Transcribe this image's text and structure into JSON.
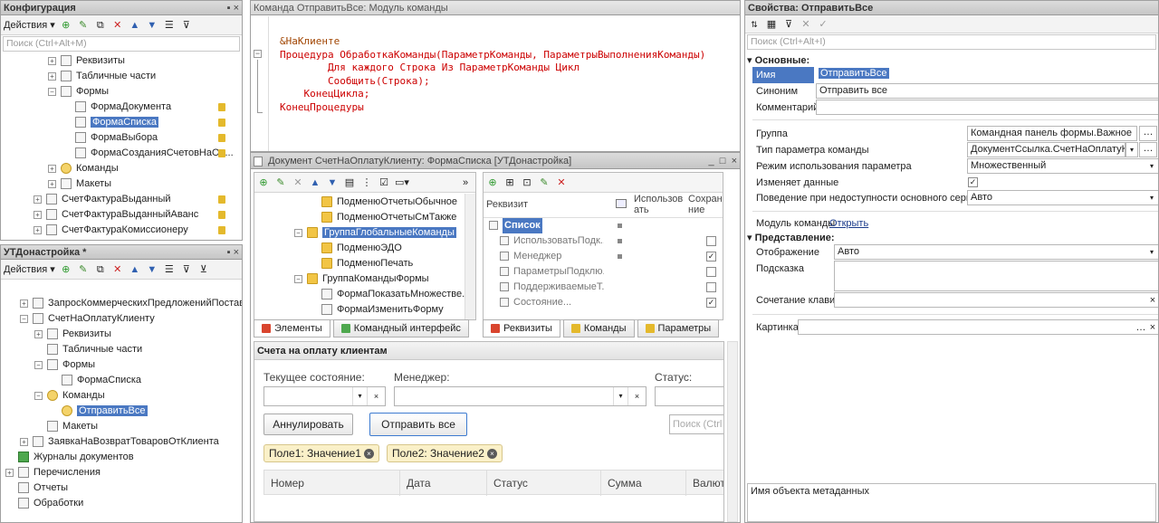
{
  "config": {
    "title": "Конфигурация",
    "actions_label": "Действия",
    "search_placeholder": "Поиск (Ctrl+Alt+M)",
    "tree": [
      {
        "label": "Реквизиты",
        "indent": 1,
        "expander": "+",
        "icon": "attributes-icon",
        "lock": false
      },
      {
        "label": "Табличные части",
        "indent": 1,
        "expander": "+",
        "icon": "table-icon",
        "lock": false
      },
      {
        "label": "Формы",
        "indent": 1,
        "expander": "−",
        "icon": "forms-icon",
        "lock": false
      },
      {
        "label": "ФормаДокумента",
        "indent": 2,
        "expander": "",
        "icon": "form-icon",
        "lock": true
      },
      {
        "label": "ФормаСписка",
        "indent": 2,
        "expander": "",
        "icon": "form-icon",
        "lock": true,
        "selected": true
      },
      {
        "label": "ФормаВыбора",
        "indent": 2,
        "expander": "",
        "icon": "form-icon",
        "lock": true
      },
      {
        "label": "ФормаСозданияСчетовНаОп...",
        "indent": 2,
        "expander": "",
        "icon": "form-icon",
        "lock": true
      },
      {
        "label": "Команды",
        "indent": 1,
        "expander": "+",
        "icon": "command-icon",
        "lock": false
      },
      {
        "label": "Макеты",
        "indent": 1,
        "expander": "+",
        "icon": "template-icon",
        "lock": false
      },
      {
        "label": "СчетФактураВыданный",
        "indent": 0,
        "expander": "+",
        "icon": "document-icon",
        "lock": true
      },
      {
        "label": "СчетФактураВыданныйАванс",
        "indent": 0,
        "expander": "+",
        "icon": "document-icon",
        "lock": true
      },
      {
        "label": "СчетФактураКомиссионеру",
        "indent": 0,
        "expander": "+",
        "icon": "document-icon",
        "lock": true
      }
    ]
  },
  "ut": {
    "title": "УТДонастройка *",
    "actions_label": "Действия",
    "tree": [
      {
        "label": "ЗапросКоммерческихПредложенийПостав",
        "indent": 1,
        "expander": "+",
        "icon": "document-icon"
      },
      {
        "label": "СчетНаОплатуКлиенту",
        "indent": 1,
        "expander": "−",
        "icon": "document-icon"
      },
      {
        "label": "Реквизиты",
        "indent": 2,
        "expander": "+",
        "icon": "attributes-icon"
      },
      {
        "label": "Табличные части",
        "indent": 2,
        "expander": "",
        "icon": "table-icon"
      },
      {
        "label": "Формы",
        "indent": 2,
        "expander": "−",
        "icon": "forms-icon"
      },
      {
        "label": "ФормаСписка",
        "indent": 3,
        "expander": "",
        "icon": "form-icon"
      },
      {
        "label": "Команды",
        "indent": 2,
        "expander": "−",
        "icon": "command-icon"
      },
      {
        "label": "ОтправитьВсе",
        "indent": 3,
        "expander": "",
        "icon": "command-icon",
        "selected": true
      },
      {
        "label": "Макеты",
        "indent": 2,
        "expander": "",
        "icon": "template-icon"
      },
      {
        "label": "ЗаявкаНаВозвратТоваровОтКлиента",
        "indent": 1,
        "expander": "+",
        "icon": "document-icon"
      },
      {
        "label": "Журналы документов",
        "indent": 0,
        "expander": "",
        "icon": "journal-icon"
      },
      {
        "label": "Перечисления",
        "indent": 0,
        "expander": "+",
        "icon": "enum-icon"
      },
      {
        "label": "Отчеты",
        "indent": 0,
        "expander": "",
        "icon": "report-icon"
      },
      {
        "label": "Обработки",
        "indent": 0,
        "expander": "",
        "icon": "processing-icon"
      }
    ]
  },
  "module": {
    "title": "Команда ОтправитьВсе: Модуль команды",
    "lines": [
      "&НаКлиенте",
      "Процедура ОбработкаКоманды(ПараметрКоманды, ПараметрыВыполненияКоманды)",
      "        Для каждого Строка Из ПараметрКоманды Цикл",
      "        Сообщить(Строка);",
      "    КонецЦикла;",
      "КонецПроцедуры"
    ]
  },
  "form_editor": {
    "title": "Документ СчетНаОплатуКлиенту: ФормаСписка [УТДонастройка]",
    "elements": [
      {
        "label": "ПодменюОтчетыОбычное",
        "indent": 2,
        "icon": "folder-icon",
        "expander": ""
      },
      {
        "label": "ПодменюОтчетыСмТакже",
        "indent": 2,
        "icon": "folder-icon",
        "expander": ""
      },
      {
        "label": "ГруппаГлобальныеКоманды",
        "indent": 1,
        "icon": "folder-icon",
        "expander": "−",
        "selected": true
      },
      {
        "label": "ПодменюЭДО",
        "indent": 2,
        "icon": "folder-icon",
        "expander": ""
      },
      {
        "label": "ПодменюПечать",
        "indent": 2,
        "icon": "folder-icon",
        "expander": ""
      },
      {
        "label": "ГруппаКомандыФормы",
        "indent": 1,
        "icon": "folder-icon",
        "expander": "−"
      },
      {
        "label": "ФормаПоказатьМножестве...",
        "indent": 2,
        "icon": "ok-button-icon",
        "expander": ""
      },
      {
        "label": "ФормаИзменитьФорму",
        "indent": 2,
        "icon": "ok-button-icon",
        "expander": ""
      }
    ],
    "attr_headers": {
      "attr": "Реквизит",
      "use": "Использов ать",
      "save": "Сохране ние"
    },
    "attributes": [
      {
        "label": "Список",
        "use_dot": true,
        "save": "",
        "bold": true,
        "selected": true
      },
      {
        "label": "ИспользоватьПодк...",
        "use_dot": true,
        "save": "unchecked"
      },
      {
        "label": "Менеджер",
        "use_dot": true,
        "save": "checked"
      },
      {
        "label": "ПараметрыПодклю...",
        "use_dot": false,
        "save": "unchecked"
      },
      {
        "label": "ПоддерживаемыеТ...",
        "use_dot": false,
        "save": "unchecked"
      },
      {
        "label": "Состояние...",
        "use_dot": false,
        "save": "checked"
      }
    ],
    "left_tabs": [
      "Элементы",
      "Командный интерфейс"
    ],
    "right_tabs": [
      "Реквизиты",
      "Команды",
      "Параметры"
    ]
  },
  "preview": {
    "title": "Счета на оплату клиентам",
    "state_label": "Текущее состояние:",
    "manager_label": "Менеджер:",
    "status_label": "Статус:",
    "cancel_button": "Аннулировать",
    "send_button": "Отправить все",
    "search_placeholder": "Поиск (Ctrl",
    "chips": [
      "Поле1: Значение1",
      "Поле2: Значение2"
    ],
    "columns": [
      "Номер",
      "Дата",
      "Статус",
      "Сумма",
      "Валют"
    ]
  },
  "props": {
    "title": "Свойства: ОтправитьВсе",
    "search_placeholder": "Поиск (Ctrl+Alt+I)",
    "section_main": "Основные:",
    "name_label": "Имя",
    "name_value": "ОтправитьВсе",
    "synonym_label": "Синоним",
    "synonym_value": "Отправить все",
    "comment_label": "Комментарий",
    "group_label": "Группа",
    "group_value": "Командная панель формы.Важное",
    "param_type_label": "Тип параметра команды",
    "param_type_value": "ДокументСсылка.СчетНаОплатуКлие",
    "param_mode_label": "Режим использования параметра",
    "param_mode_value": "Множественный",
    "modifies_label": "Изменяет данные",
    "behavior_label": "Поведение при недоступности основного сервера",
    "behavior_value": "Авто",
    "module_label": "Модуль команды",
    "module_link": "Открыть",
    "section_view": "Представление:",
    "display_label": "Отображение",
    "display_value": "Авто",
    "hint_label": "Подсказка",
    "shortcut_label": "Сочетание клавиш",
    "picture_label": "Картинка",
    "footer": "Имя объекта метаданных"
  }
}
